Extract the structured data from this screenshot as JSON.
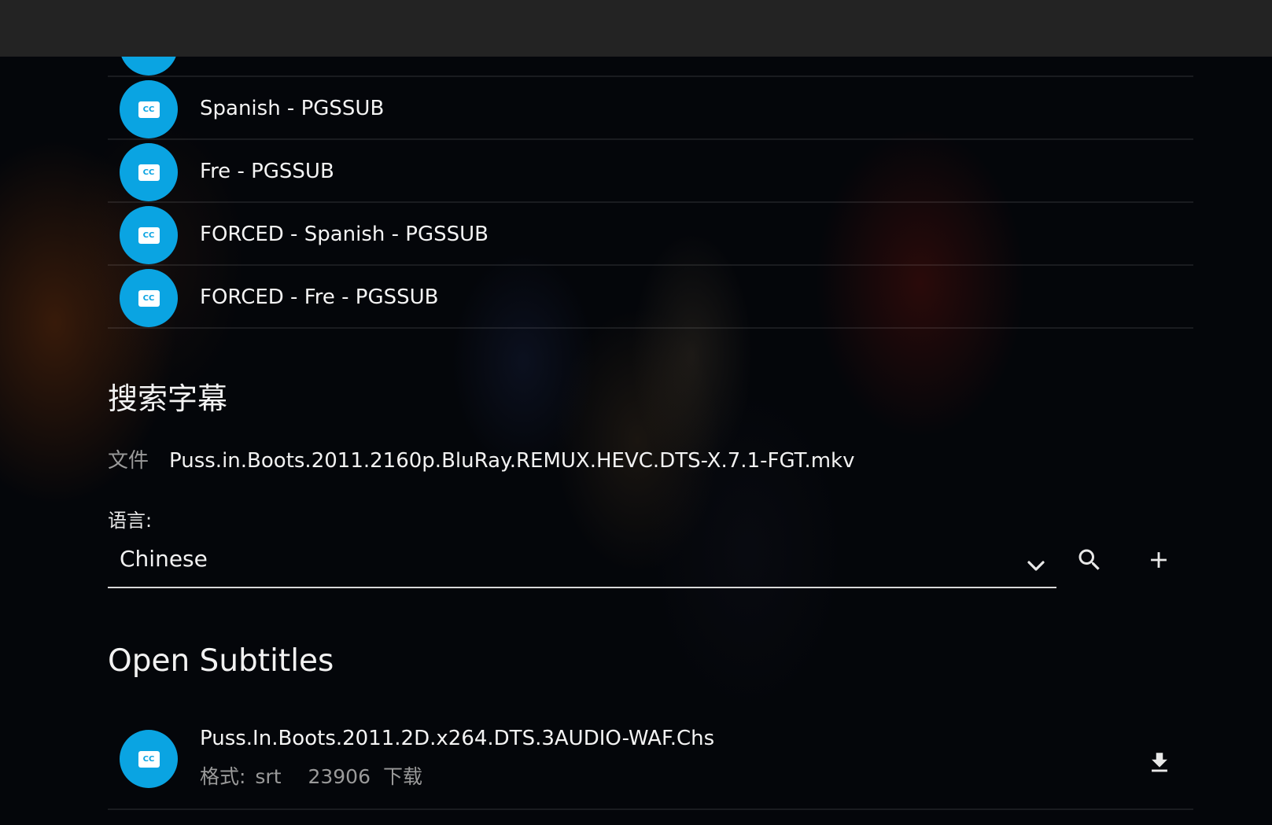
{
  "tracks": [
    {
      "label": "",
      "icon": "closed-caption-icon"
    },
    {
      "label": "Spanish - PGSSUB",
      "icon": "closed-caption-icon"
    },
    {
      "label": "Fre - PGSSUB",
      "icon": "closed-caption-icon"
    },
    {
      "label": "FORCED - Spanish - PGSSUB",
      "icon": "closed-caption-icon"
    },
    {
      "label": "FORCED - Fre - PGSSUB",
      "icon": "closed-caption-icon"
    }
  ],
  "cc_badge": "CC",
  "search": {
    "title": "搜索字幕",
    "file_label": "文件",
    "file_value": "Puss.in.Boots.2011.2160p.BluRay.REMUX.HEVC.DTS-X.7.1-FGT.mkv",
    "language_label": "语言:",
    "language_value": "Chinese",
    "icons": [
      "chevron-down-icon",
      "search-icon",
      "plus-icon"
    ]
  },
  "results": {
    "provider": "Open Subtitles",
    "items": [
      {
        "title": "Puss.In.Boots.2011.2D.x264.DTS.3AUDIO-WAF.Chs",
        "format_label": "格式:",
        "format_value": "srt",
        "downloads": "23906",
        "downloads_label": "下载",
        "icon": "download-icon"
      }
    ]
  },
  "colors": {
    "accent": "#0aa4e2",
    "topbar": "#232323",
    "background": "#04060a"
  }
}
